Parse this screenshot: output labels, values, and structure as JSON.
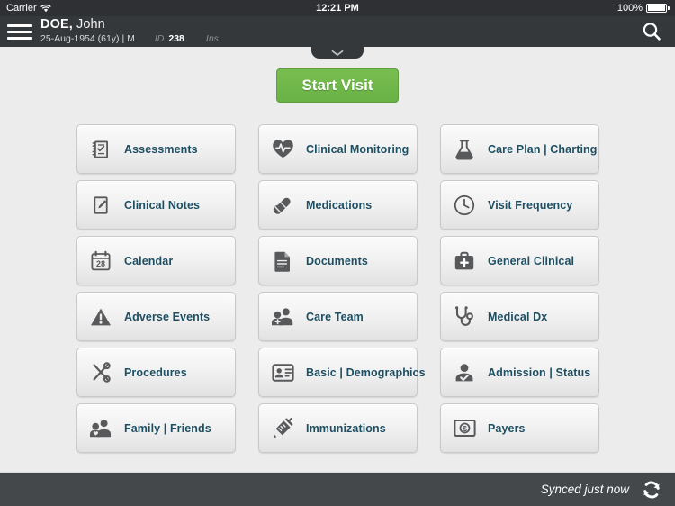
{
  "statusbar": {
    "carrier": "Carrier",
    "wifi_icon": "wifi-icon",
    "time": "12:21 PM",
    "battery_percent": "100%",
    "battery_icon": "battery-full-icon"
  },
  "header": {
    "menu_icon": "hamburger-menu-icon",
    "patient_last_name": "DOE,",
    "patient_first_name": " John",
    "dob_line": "25-Aug-1954 (61y) | M",
    "id_label": "ID",
    "id_value": "238",
    "insurance_label": "Ins",
    "search_icon": "search-icon",
    "pulltab_icon": "chevron-down-icon"
  },
  "actions": {
    "start_visit_label": "Start Visit",
    "start_visit_color": "#6fb44a"
  },
  "grid": {
    "tiles": [
      {
        "label": "Assessments",
        "icon": "clipboard-check-icon"
      },
      {
        "label": "Clinical Monitoring",
        "icon": "heart-pulse-icon"
      },
      {
        "label": "Care Plan | Charting",
        "icon": "flask-icon"
      },
      {
        "label": "Clinical Notes",
        "icon": "note-pencil-icon"
      },
      {
        "label": "Medications",
        "icon": "pills-capsule-icon"
      },
      {
        "label": "Visit Frequency",
        "icon": "clock-icon"
      },
      {
        "label": "Calendar",
        "icon": "calendar-28-icon"
      },
      {
        "label": "Documents",
        "icon": "document-icon"
      },
      {
        "label": "General Clinical",
        "icon": "medical-bag-icon"
      },
      {
        "label": "Adverse Events",
        "icon": "warning-triangle-icon"
      },
      {
        "label": "Care Team",
        "icon": "people-add-icon"
      },
      {
        "label": "Medical Dx",
        "icon": "stethoscope-icon"
      },
      {
        "label": "Procedures",
        "icon": "scissors-icon"
      },
      {
        "label": "Basic | Demographics",
        "icon": "id-card-icon"
      },
      {
        "label": "Admission | Status",
        "icon": "person-check-icon"
      },
      {
        "label": "Family | Friends",
        "icon": "people-heart-icon"
      },
      {
        "label": "Immunizations",
        "icon": "syringe-icon"
      },
      {
        "label": "Payers",
        "icon": "dollar-bill-icon"
      }
    ],
    "calendar_day": "28",
    "label_color": "#1d4f63",
    "icon_color": "#58595b"
  },
  "footer": {
    "sync_status": "Synced just now",
    "sync_icon": "sync-refresh-icon"
  }
}
